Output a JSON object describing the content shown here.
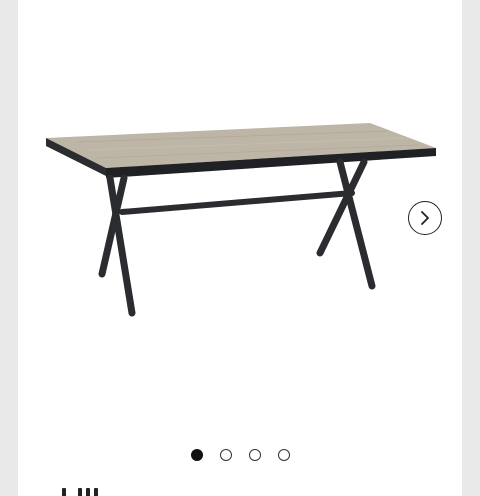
{
  "gallery": {
    "image_alt": "",
    "slide_count": 4,
    "active_index": 0,
    "next_icon": "chevron-right-icon"
  },
  "colors": {
    "tabletop": "#bdb5a6",
    "frame": "#2a2c2f",
    "dot_active": "#111111",
    "page_bg": "#e9e9e9"
  }
}
